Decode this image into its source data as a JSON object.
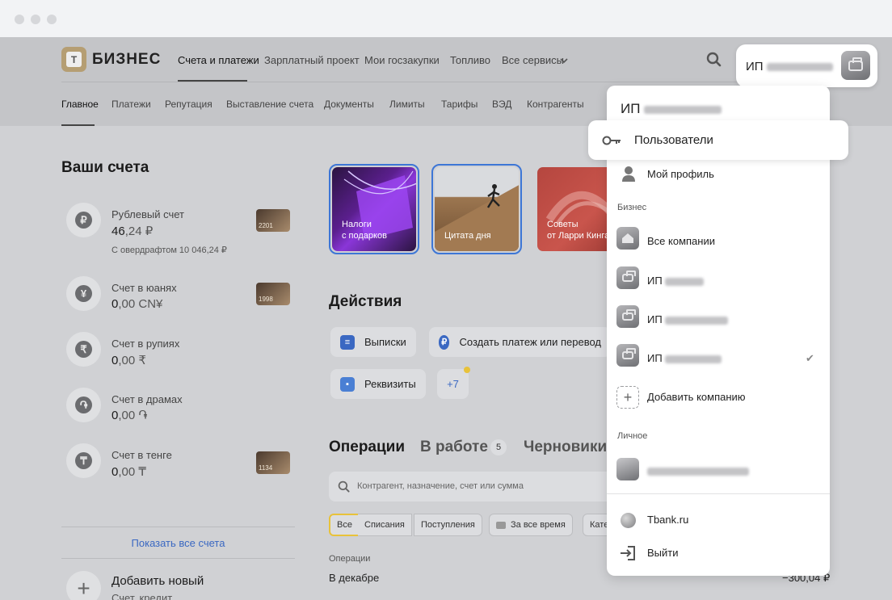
{
  "header": {
    "logo_letter": "Т",
    "brand": "БИЗНЕС",
    "main_nav": [
      "Счета и платежи",
      "Зарплатный проект",
      "Мои госзакупки",
      "Топливо",
      "Все сервисы"
    ],
    "sub_nav": [
      "Главное",
      "Платежи",
      "Репутация",
      "Выставление счета",
      "Документы",
      "Лимиты",
      "Тарифы",
      "ВЭД",
      "Контрагенты"
    ],
    "account_prefix": "ИП"
  },
  "accounts": {
    "title": "Ваши счета",
    "items": [
      {
        "icon": "₽",
        "name": "Рублевый счет",
        "balance_int": "46",
        "balance_frac": ",24 ₽",
        "note": "С овердрафтом 10 046,24 ₽",
        "card": "2201"
      },
      {
        "icon": "¥",
        "name": "Счет в юанях",
        "balance_int": "0",
        "balance_frac": ",00 CN¥",
        "card": "1998"
      },
      {
        "icon": "₹",
        "name": "Счет в рупиях",
        "balance_int": "0",
        "balance_frac": ",00 ₹"
      },
      {
        "icon": "֏",
        "name": "Счет в драмах",
        "balance_int": "0",
        "balance_frac": ",00 ֏"
      },
      {
        "icon": "₸",
        "name": "Счет в тенге",
        "balance_int": "0",
        "balance_frac": ",00 ₸",
        "card": "1134"
      }
    ],
    "show_all": "Показать все счета",
    "add_new_title": "Добавить новый",
    "add_new_sub": "Счет, кредит"
  },
  "stories": [
    {
      "caption": "Налоги\nс подарков"
    },
    {
      "caption": "Цитата дня"
    },
    {
      "caption": "Советы\nот Ларри Кинга"
    }
  ],
  "actions": {
    "title": "Действия",
    "items": [
      "Выписки",
      "Создать платеж или перевод",
      "Реквизиты"
    ],
    "more": "+7"
  },
  "operations": {
    "tabs": [
      "Операции",
      "В работе",
      "Черновики"
    ],
    "in_work_count": "5",
    "search_placeholder": "Контрагент, назначение, счет или сумма",
    "filters": [
      "Все",
      "Списания",
      "Поступления",
      "За все время",
      "Кате"
    ],
    "section_label": "Операции",
    "month_label": "В декабре",
    "month_amount": "−300,04 ₽"
  },
  "dropdown": {
    "title_prefix": "ИП",
    "users": "Пользователи",
    "profile": "Мой профиль",
    "business_section": "Бизнес",
    "all_companies": "Все компании",
    "company_prefix": "ИП",
    "add_company": "Добавить компанию",
    "personal_section": "Личное",
    "site": "Tbank.ru",
    "logout": "Выйти"
  }
}
